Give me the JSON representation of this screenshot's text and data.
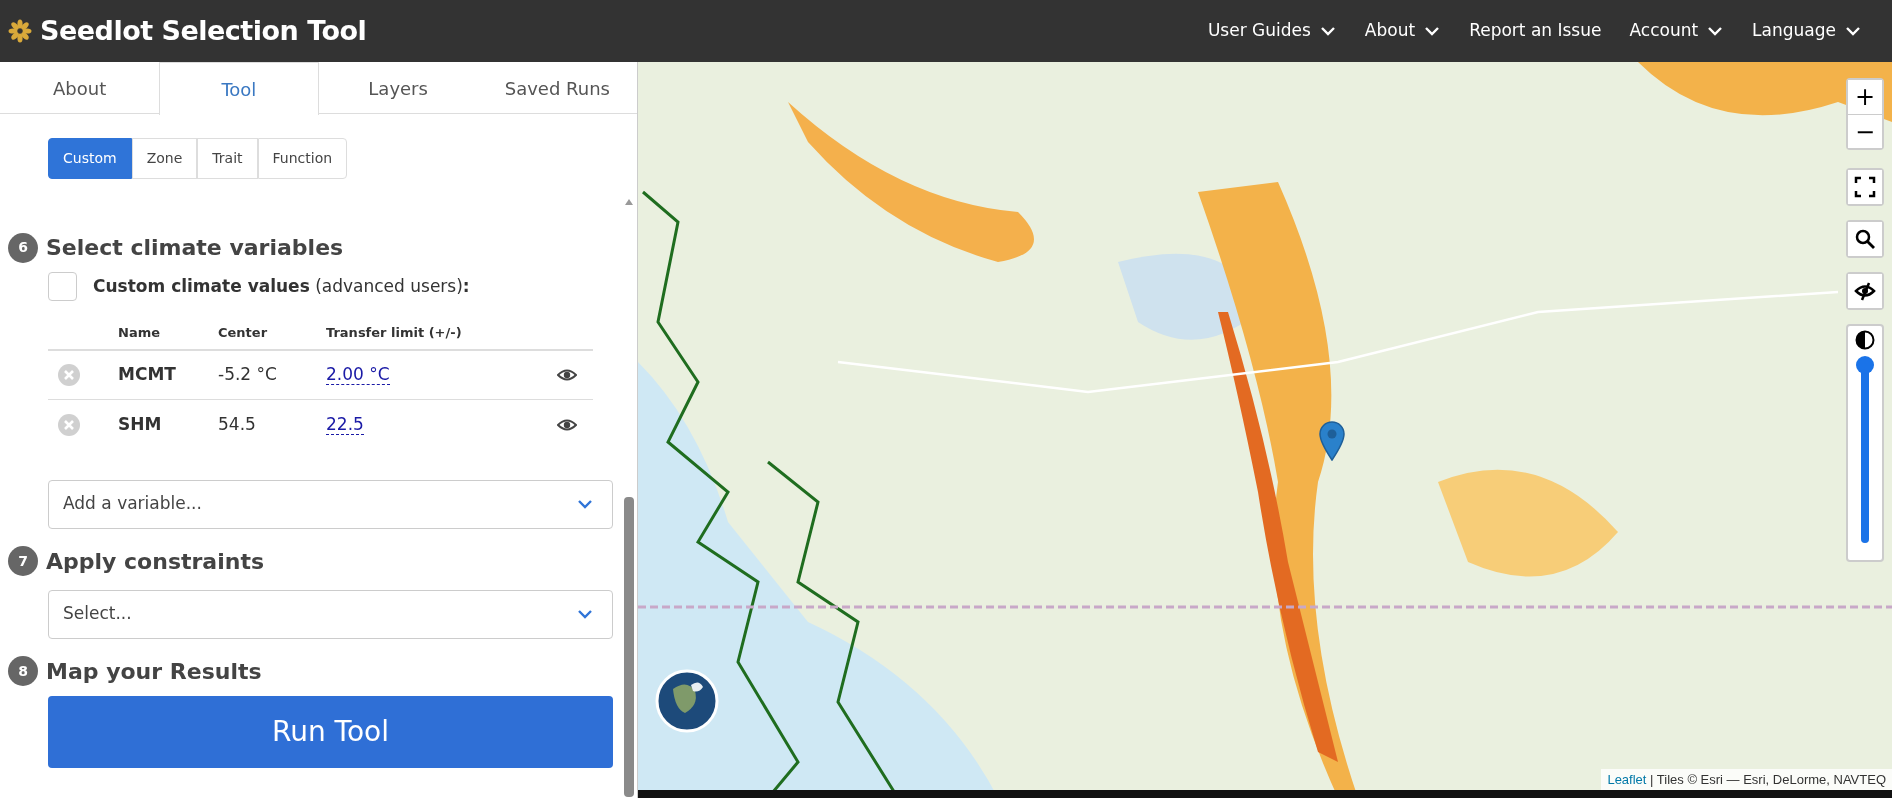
{
  "header": {
    "title": "Seedlot Selection Tool",
    "nav": [
      {
        "label": "User Guides",
        "dropdown": true
      },
      {
        "label": "About",
        "dropdown": true
      },
      {
        "label": "Report an Issue",
        "dropdown": false
      },
      {
        "label": "Account",
        "dropdown": true
      },
      {
        "label": "Language",
        "dropdown": true
      }
    ]
  },
  "tabs": [
    {
      "label": "About",
      "selected": false
    },
    {
      "label": "Tool",
      "selected": true
    },
    {
      "label": "Layers",
      "selected": false
    },
    {
      "label": "Saved Runs",
      "selected": false
    }
  ],
  "modes": [
    {
      "label": "Custom",
      "selected": true
    },
    {
      "label": "Zone",
      "selected": false
    },
    {
      "label": "Trait",
      "selected": false
    },
    {
      "label": "Function",
      "selected": false
    }
  ],
  "climate_step": {
    "number": "6",
    "title": "Select climate variables",
    "custom_values": {
      "label": "**Custom climate values** (advanced users)**:**",
      "checked": false
    },
    "table": {
      "columns": [
        "Name",
        "Center",
        "Transfer limit (+/-)"
      ],
      "rows": [
        {
          "name": "MCMT",
          "center": "-5.2 °C",
          "transfer_limit": "2.00 °C",
          "visible": true
        },
        {
          "name": "SHM",
          "center": "54.5",
          "transfer_limit": "22.5",
          "visible": true
        }
      ]
    },
    "add_variable": {
      "placeholder": "Add a variable..."
    }
  },
  "constraints_step": {
    "number": "7",
    "title": "Apply constraints",
    "select": {
      "placeholder": "Select..."
    }
  },
  "results_step": {
    "number": "8",
    "title": "Map your Results",
    "button": "Run Tool"
  },
  "map": {
    "zoom_in": "+",
    "zoom_out": "−",
    "opacity": {
      "level": 1
    },
    "attribution": {
      "link": "Leaflet",
      "text": " | Tiles © Esri — Esri, DeLorme, NAVTEQ"
    }
  }
}
